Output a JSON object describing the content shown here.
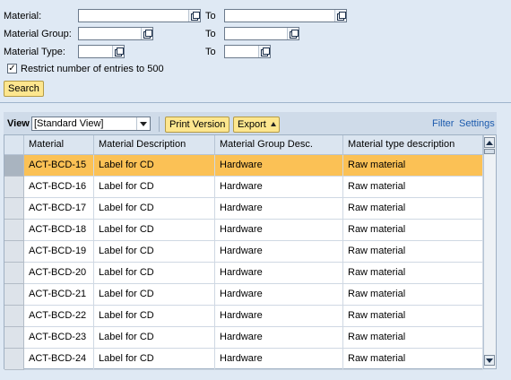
{
  "search_form": {
    "material_label": "Material:",
    "material_value": "",
    "material_to_label": "To",
    "material_to_value": "",
    "group_label": "Material Group:",
    "group_value": "",
    "group_to_label": "To",
    "group_to_value": "",
    "type_label": "Material Type:",
    "type_value": "",
    "type_to_label": "To",
    "type_to_value": "",
    "restrict_checked": true,
    "restrict_label": "Restrict number of entries to 500",
    "search_button": "Search"
  },
  "toolbar": {
    "view_label": "View",
    "view_value": "[Standard View]",
    "print_button": "Print Version",
    "export_button": "Export",
    "filter_link": "Filter",
    "settings_link": "Settings"
  },
  "table": {
    "columns": [
      "Material",
      "Material Description",
      "Material Group Desc.",
      "Material type description"
    ],
    "selected_row": 0,
    "rows": [
      [
        "ACT-BCD-15",
        "Label for CD",
        "Hardware",
        "Raw material"
      ],
      [
        "ACT-BCD-16",
        "Label for CD",
        "Hardware",
        "Raw material"
      ],
      [
        "ACT-BCD-17",
        "Label for CD",
        "Hardware",
        "Raw material"
      ],
      [
        "ACT-BCD-18",
        "Label for CD",
        "Hardware",
        "Raw material"
      ],
      [
        "ACT-BCD-19",
        "Label for CD",
        "Hardware",
        "Raw material"
      ],
      [
        "ACT-BCD-20",
        "Label for CD",
        "Hardware",
        "Raw material"
      ],
      [
        "ACT-BCD-21",
        "Label for CD",
        "Hardware",
        "Raw material"
      ],
      [
        "ACT-BCD-22",
        "Label for CD",
        "Hardware",
        "Raw material"
      ],
      [
        "ACT-BCD-23",
        "Label for CD",
        "Hardware",
        "Raw material"
      ],
      [
        "ACT-BCD-24",
        "Label for CD",
        "Hardware",
        "Raw material"
      ]
    ]
  },
  "colors": {
    "background": "#dfe9f4",
    "button": "#fde68e",
    "selected_row": "#fbc155",
    "link": "#1c5bae"
  }
}
